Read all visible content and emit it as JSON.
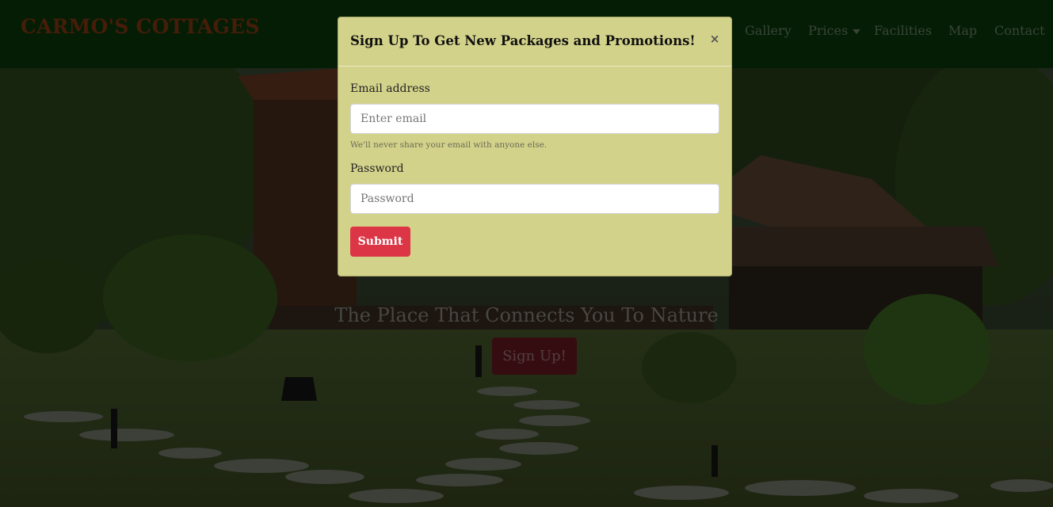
{
  "navbar": {
    "brand": "CARMO'S COTTAGES",
    "links": [
      "Gallery",
      "Prices",
      "Facilities",
      "Map",
      "Contact"
    ]
  },
  "hero": {
    "tagline": "The Place That Connects You To Nature",
    "cta_label": "Sign Up!"
  },
  "modal": {
    "title": "Sign Up To Get New Packages and Promotions!",
    "close_label": "×",
    "email_label": "Email address",
    "email_placeholder": "Enter email",
    "email_help": "We'll never share your email with anyone else.",
    "password_label": "Password",
    "password_placeholder": "Password",
    "submit_label": "Submit"
  },
  "colors": {
    "navbar_bg": "#0b3a0b",
    "brand": "#8a3a12",
    "modal_bg": "#d3d28a",
    "submit": "#dc3545"
  }
}
